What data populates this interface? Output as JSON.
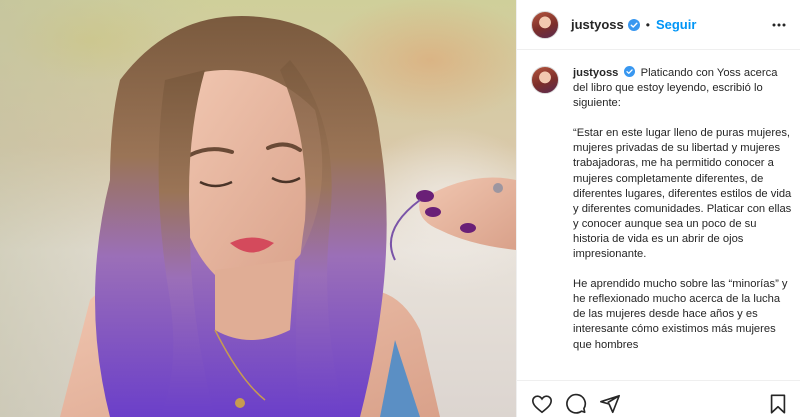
{
  "post": {
    "username": "justyoss",
    "follow_label": "Seguir",
    "separator": "•",
    "icons": {
      "verified": "verified-badge-icon",
      "more": "more-options-icon",
      "like": "heart-icon",
      "comment": "comment-icon",
      "share": "share-icon",
      "save": "bookmark-icon"
    }
  },
  "caption": {
    "username": "justyoss",
    "intro": "Platicando con Yoss acerca del libro que estoy leyendo, escribió lo siguiente:",
    "paragraph_1": "“Estar en este lugar lleno de puras mujeres, mujeres privadas de su libertad y mujeres trabajadoras, me ha permitido conocer a mujeres completamente diferentes, de diferentes lugares, diferentes estilos de vida y diferentes comunidades. Platicar con ellas y conocer aunque sea un poco de su historia de vida es un abrir de ojos impresionante.",
    "paragraph_2": "He aprendido mucho sobre las “minorías” y he reflexionado mucho acerca de la lucha de las mujeres desde hace años y es interesante cómo existimos más mujeres que hombres"
  },
  "colors": {
    "accent": "#0095f6",
    "text": "#262626",
    "border": "#efefef"
  }
}
